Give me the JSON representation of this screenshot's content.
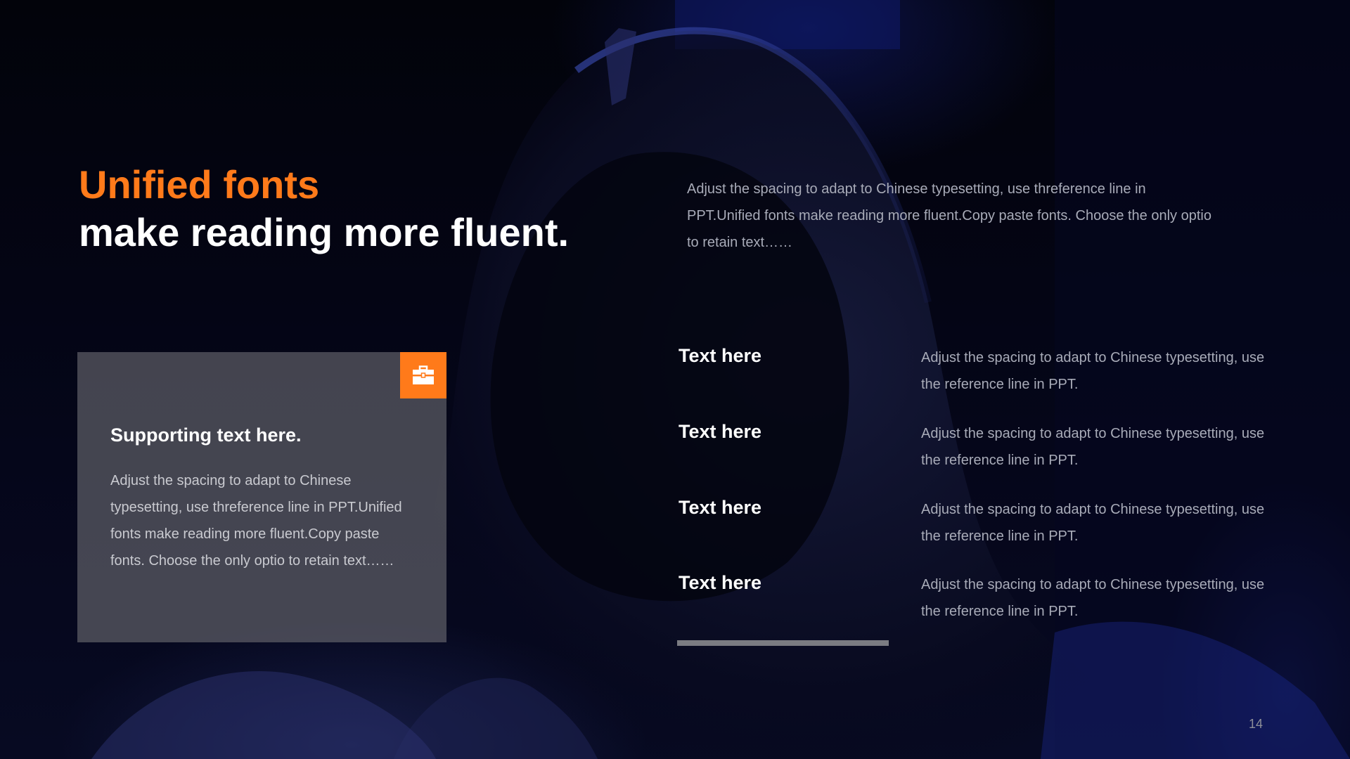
{
  "heading": {
    "line1": "Unified fonts",
    "line2": "make reading more fluent."
  },
  "intro": {
    "text": "Adjust the spacing to adapt to Chinese typesetting, use threference line in PPT.Unified fonts make reading more fluent.Copy paste fonts. Choose the only optio to retain text……"
  },
  "card": {
    "icon": "briefcase-icon",
    "title": "Supporting text here.",
    "body": "Adjust the spacing to adapt to Chinese typesetting, use threference line in PPT.Unified fonts make reading more fluent.Copy paste fonts. Choose the only optio to retain text……"
  },
  "items": [
    {
      "title": "Text here",
      "desc": "Adjust the spacing to adapt to Chinese typesetting, use the reference line in PPT."
    },
    {
      "title": "Text here",
      "desc": "Adjust the spacing to adapt to Chinese typesetting, use the reference line in PPT."
    },
    {
      "title": "Text here",
      "desc": "Adjust the spacing to adapt to Chinese typesetting, use the reference line in PPT."
    },
    {
      "title": "Text here",
      "desc": "Adjust the spacing to adapt to Chinese typesetting, use the reference line in PPT."
    }
  ],
  "page_number": "14",
  "colors": {
    "accent": "#ff7a1a",
    "background": "#03040c",
    "card": "#6c6c72"
  }
}
